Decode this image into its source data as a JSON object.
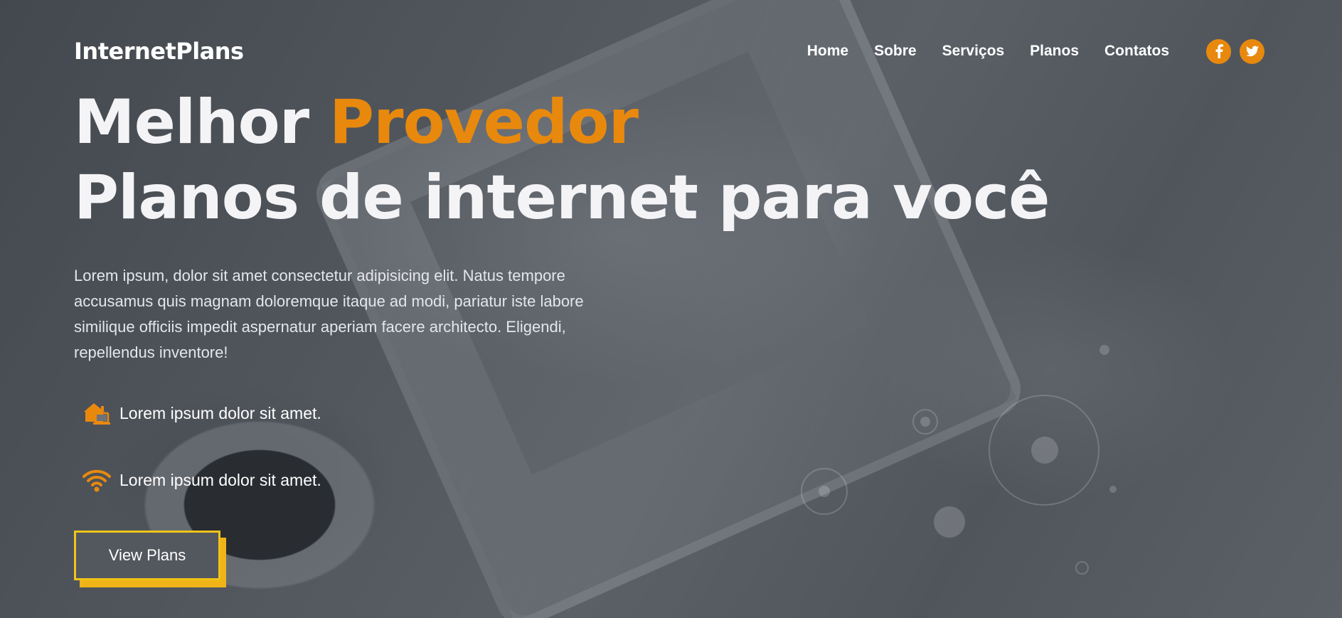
{
  "brand": "InternetPlans",
  "nav": {
    "items": [
      "Home",
      "Sobre",
      "Serviços",
      "Planos",
      "Contatos"
    ]
  },
  "social": {
    "icons": [
      "facebook-icon",
      "twitter-icon"
    ],
    "color": "#e8890d"
  },
  "hero": {
    "title_part1": "Melhor ",
    "title_accent": "Provedor",
    "title_line2": "Planos de internet para você",
    "accent_color": "#e8890d",
    "lead": "Lorem ipsum, dolor sit amet consectetur adipisicing elit. Natus tempore accusamus quis magnam doloremque itaque ad modi, pariatur iste labore similique officiis impedit aspernatur aperiam facere architecto. Eligendi, repellendus inventore!",
    "features": [
      {
        "icon": "house-laptop-icon",
        "text": "Lorem ipsum dolor sit amet."
      },
      {
        "icon": "wifi-icon",
        "text": "Lorem ipsum dolor sit amet."
      }
    ],
    "cta_label": "View Plans",
    "cta_color": "#f0c419"
  }
}
